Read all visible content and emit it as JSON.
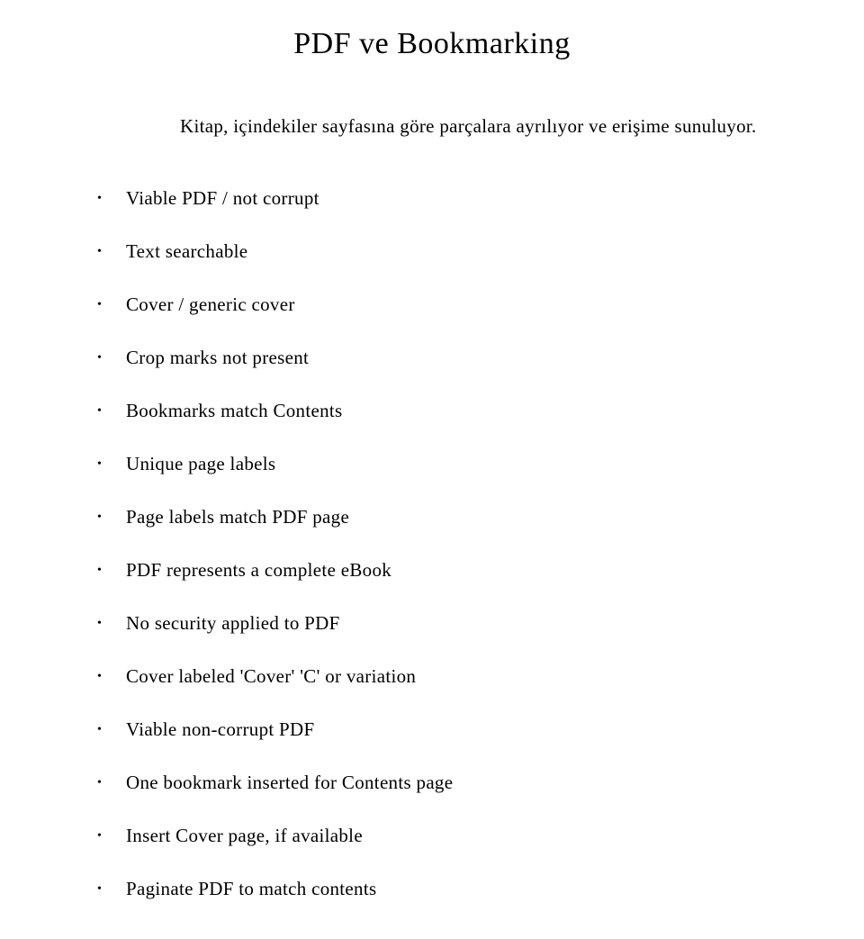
{
  "title": "PDF ve Bookmarking",
  "subtitle": "Kitap, içindekiler sayfasına göre parçalara ayrılıyor ve erişime sunuluyor.",
  "bullets": [
    "Viable PDF / not corrupt",
    "Text searchable",
    "Cover / generic cover",
    "Crop marks not present",
    "Bookmarks match Contents",
    "Unique page labels",
    "Page labels match PDF page",
    "PDF represents a complete eBook",
    "No security applied to PDF",
    "Cover labeled 'Cover' 'C' or variation",
    "Viable non-corrupt PDF",
    "One bookmark inserted for Contents page",
    "Insert Cover page, if available",
    "Paginate PDF to match contents"
  ]
}
